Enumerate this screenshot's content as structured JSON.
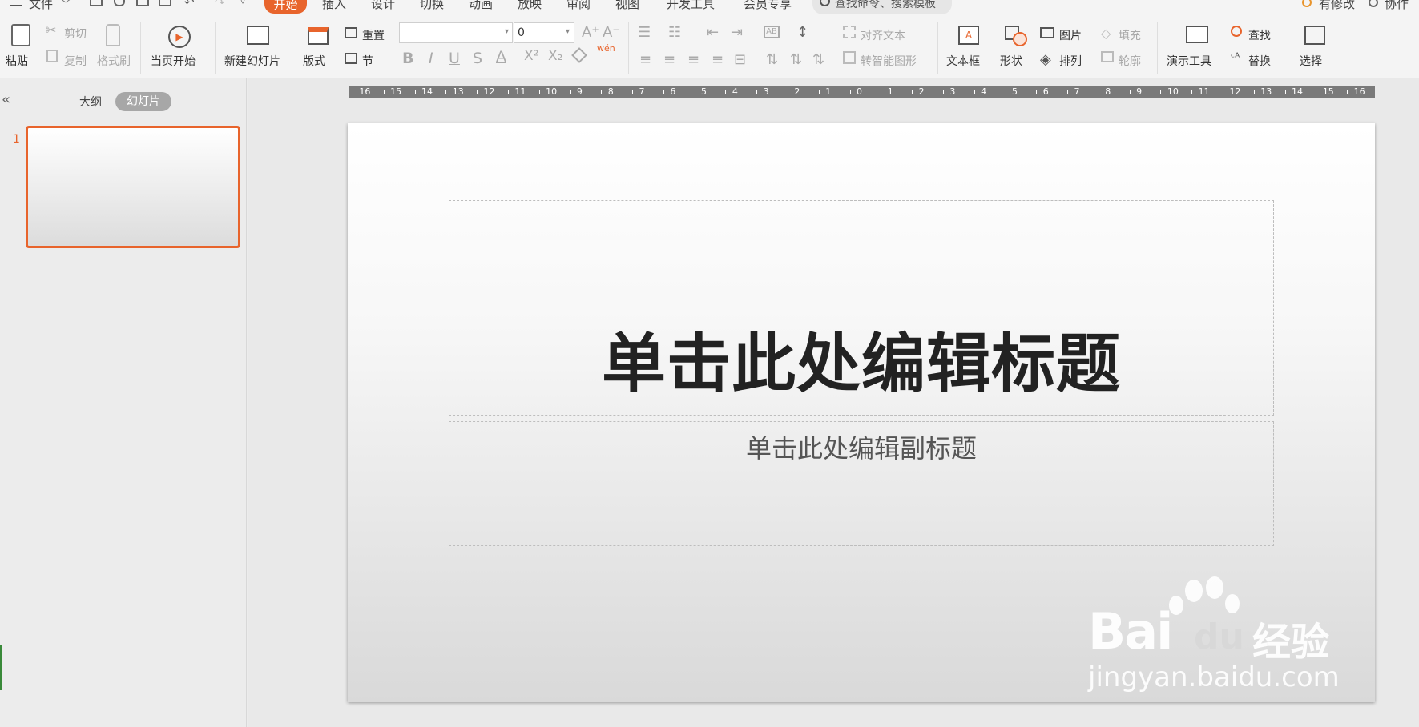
{
  "menubar": {
    "file": "文件",
    "tabs": [
      "开始",
      "插入",
      "设计",
      "切换",
      "动画",
      "放映",
      "审阅",
      "视图",
      "开发工具",
      "会员专享"
    ],
    "search_placeholder": "查找命令、搜索模板",
    "pending": "有修改",
    "collab": "协作"
  },
  "ribbon": {
    "paste": "粘贴",
    "cut": "剪切",
    "copy": "复制",
    "format_painter": "格式刷",
    "play_from_start": "当页开始",
    "new_slide": "新建幻灯片",
    "layout": "版式",
    "reset": "重置",
    "section": "节",
    "font_name": "",
    "font_size": "0",
    "align_text": "对齐文本",
    "smartart": "转智能图形",
    "textbox": "文本框",
    "shape": "形状",
    "picture": "图片",
    "arrange": "排列",
    "fill": "填充",
    "outline": "轮廓",
    "present_tools": "演示工具",
    "find": "查找",
    "replace": "替换",
    "select": "选择",
    "phonetic": "wén"
  },
  "panel": {
    "tab_outline": "大纲",
    "tab_slides": "幻灯片",
    "slide_number": "1"
  },
  "ruler": {
    "ticks": [
      "16",
      "15",
      "14",
      "13",
      "12",
      "11",
      "10",
      "9",
      "8",
      "7",
      "6",
      "5",
      "4",
      "3",
      "2",
      "1",
      "0",
      "1",
      "2",
      "3",
      "4",
      "5",
      "6",
      "7",
      "8",
      "9",
      "10",
      "11",
      "12",
      "13",
      "14",
      "15",
      "16"
    ]
  },
  "slide": {
    "title": "单击此处编辑标题",
    "subtitle": "单击此处编辑副标题"
  },
  "watermark": {
    "brand": "Bai",
    "brand2": "du",
    "brand_cn": "经验",
    "url": "jingyan.baidu.com"
  },
  "colors": {
    "accent": "#e8642c"
  }
}
